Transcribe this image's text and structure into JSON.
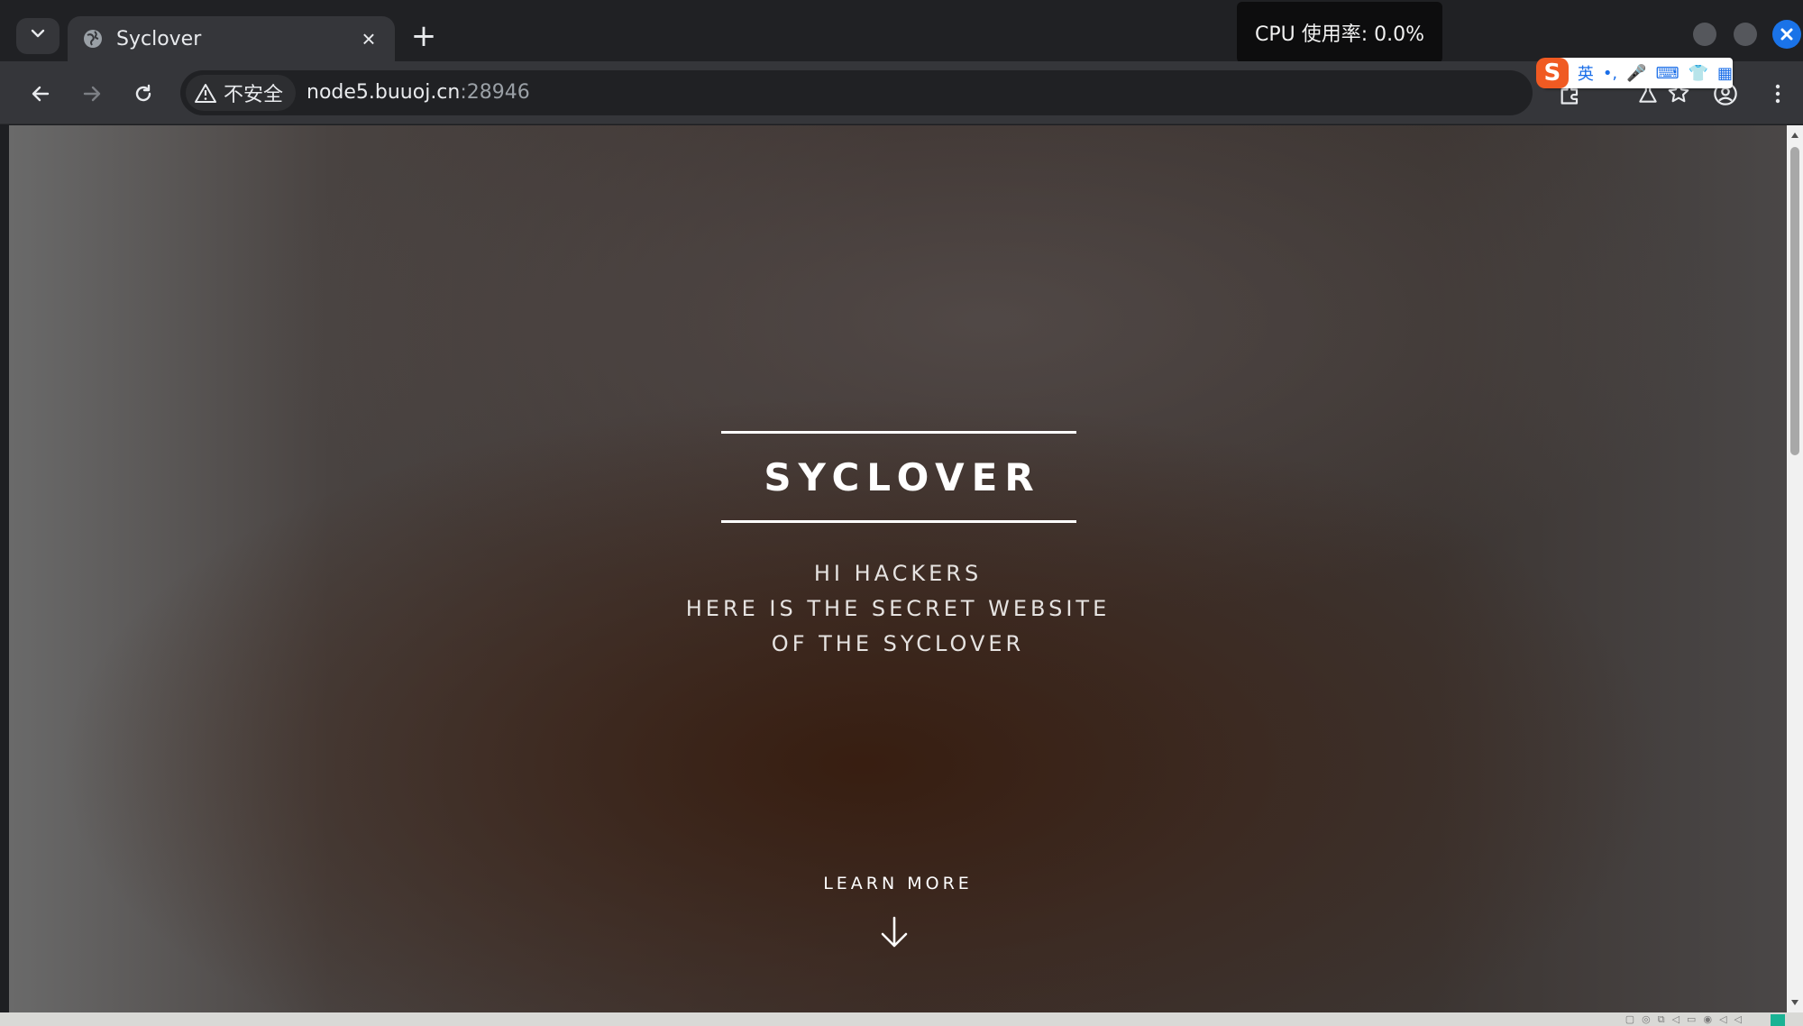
{
  "browser": {
    "tab": {
      "title": "Syclover",
      "close_glyph": "×"
    },
    "new_tab_glyph": "+",
    "tab_search_glyph": "⌄",
    "cpu_overlay": "CPU 使用率: 0.0%",
    "security_label": "不安全",
    "url": {
      "host": "node5.buuoj.cn",
      "port": ":28946"
    },
    "ime": {
      "logo": "S",
      "mode": "英",
      "punct": "•,",
      "mic": "🎤",
      "keyboard": "⌨",
      "skin": "👕",
      "apps": "▦"
    }
  },
  "page": {
    "title": "SYCLOVER",
    "subtitle_lines": [
      "HI HACKERS",
      "HERE IS THE SECRET WEBSITE",
      "OF THE SYCLOVER"
    ],
    "learn_more": "LEARN MORE"
  },
  "colors": {
    "accent": "#1a73e8",
    "tab_bg": "#35363a",
    "strip_bg": "#202124",
    "tray_indicator": "#1ab394"
  },
  "icons": [
    "tab-search-icon",
    "globe-icon",
    "close-icon",
    "plus-icon",
    "back-icon",
    "forward-icon",
    "reload-icon",
    "warning-icon",
    "star-icon",
    "extensions-icon",
    "labs-icon",
    "profile-icon",
    "menu-icon",
    "arrow-down-icon"
  ]
}
